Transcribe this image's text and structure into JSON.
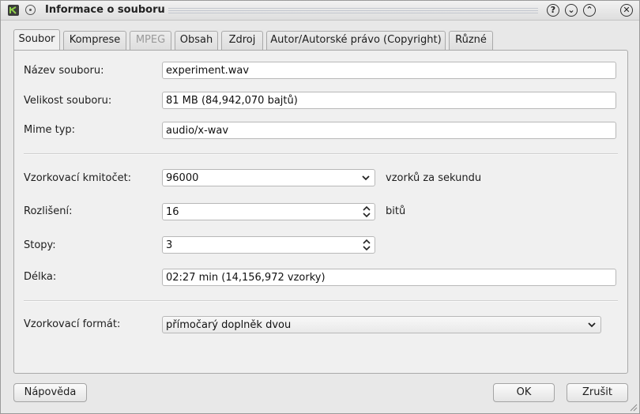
{
  "window": {
    "title": "Informace o souboru",
    "buttons": [
      "?",
      "⌄",
      "⌃",
      "✕"
    ]
  },
  "tabs": [
    {
      "label": "Soubor",
      "active": true,
      "disabled": false
    },
    {
      "label": "Komprese",
      "active": false,
      "disabled": false
    },
    {
      "label": "MPEG",
      "active": false,
      "disabled": true
    },
    {
      "label": "Obsah",
      "active": false,
      "disabled": false
    },
    {
      "label": "Zdroj",
      "active": false,
      "disabled": false
    },
    {
      "label": "Autor/Autorské právo (Copyright)",
      "active": false,
      "disabled": false
    },
    {
      "label": "Různé",
      "active": false,
      "disabled": false
    }
  ],
  "form": {
    "filename": {
      "label": "Název souboru:",
      "value": "experiment.wav"
    },
    "filesize": {
      "label": "Velikost souboru:",
      "value": "81 MB (84,942,070 bajtů)"
    },
    "mime": {
      "label": "Mime typ:",
      "value": "audio/x-wav"
    },
    "samplerate": {
      "label": "Vzorkovací kmitočet:",
      "value": "96000",
      "unit": "vzorků za sekundu"
    },
    "resolution": {
      "label": "Rozlišení:",
      "value": "16",
      "unit": "bitů"
    },
    "tracks": {
      "label": "Stopy:",
      "value": "3"
    },
    "length": {
      "label": "Délka:",
      "value": "02:27 min (14,156,972 vzorky)"
    },
    "sampleformat": {
      "label": "Vzorkovací formát:",
      "value": "přímočarý doplněk dvou"
    }
  },
  "footer": {
    "help": "Nápověda",
    "ok": "OK",
    "cancel": "Zrušit"
  }
}
